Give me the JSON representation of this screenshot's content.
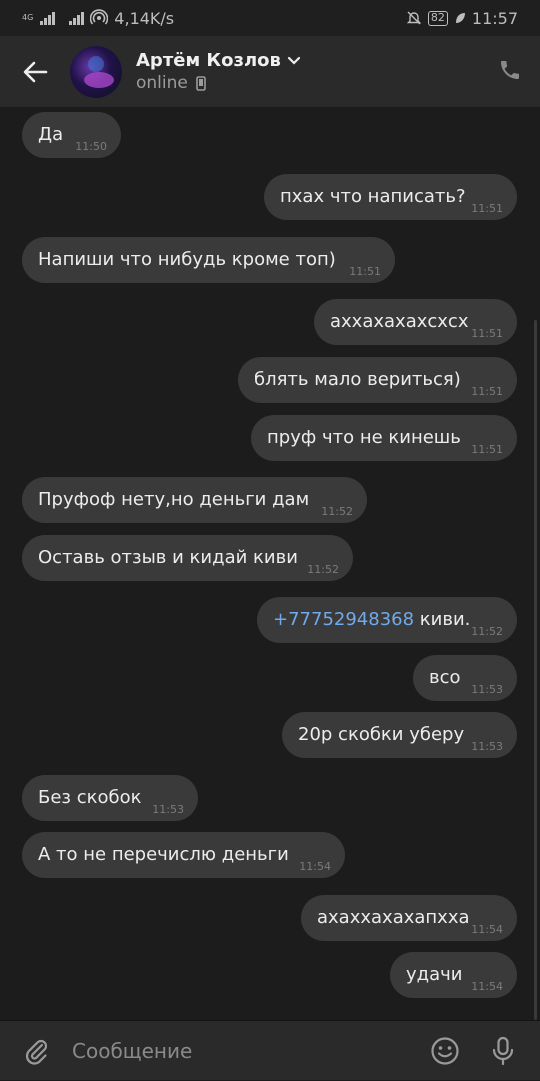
{
  "status_bar": {
    "network_type": "4G",
    "speed": "4,14K/s",
    "battery": "82",
    "time": "11:57"
  },
  "header": {
    "contact_name": "Артём Козлов",
    "status": "online"
  },
  "messages": [
    {
      "dir": "in",
      "text": "Да",
      "time": "11:50"
    },
    {
      "dir": "out",
      "text": "пхах что написать?",
      "time": "11:51"
    },
    {
      "dir": "in",
      "text": "Напиши что нибудь кроме топ)",
      "time": "11:51"
    },
    {
      "dir": "out",
      "text": "аххахахахсхсх",
      "time": "11:51"
    },
    {
      "dir": "out",
      "text": "блять мало вериться)",
      "time": "11:51"
    },
    {
      "dir": "out",
      "text": "пруф что не кинешь",
      "time": "11:51"
    },
    {
      "dir": "in",
      "text": "Пруфоф нету,но деньги дам",
      "time": "11:52"
    },
    {
      "dir": "in",
      "text": "Оставь отзыв и кидай киви",
      "time": "11:52"
    },
    {
      "dir": "out",
      "link": "+77752948368",
      "text": " киви.",
      "time": "11:52"
    },
    {
      "dir": "out",
      "text": "всо",
      "time": "11:53"
    },
    {
      "dir": "out",
      "text": "20р скобки уберу",
      "time": "11:53"
    },
    {
      "dir": "in",
      "text": "Без скобок",
      "time": "11:53"
    },
    {
      "dir": "in",
      "text": "А то не перечислю деньги",
      "time": "11:54"
    },
    {
      "dir": "out",
      "text": "ахаххахахапхха",
      "time": "11:54"
    },
    {
      "dir": "out",
      "text": "удачи",
      "time": "11:54"
    }
  ],
  "composer": {
    "placeholder": "Сообщение"
  },
  "icons": {
    "back": "arrow-left-icon",
    "call": "phone-icon",
    "attach": "paperclip-icon",
    "emoji": "smiley-icon",
    "mic": "microphone-icon"
  },
  "colors": {
    "background": "#1c1c1c",
    "bubble": "#3a3a3a",
    "link": "#71aaeb",
    "header": "#2a2a2a"
  }
}
